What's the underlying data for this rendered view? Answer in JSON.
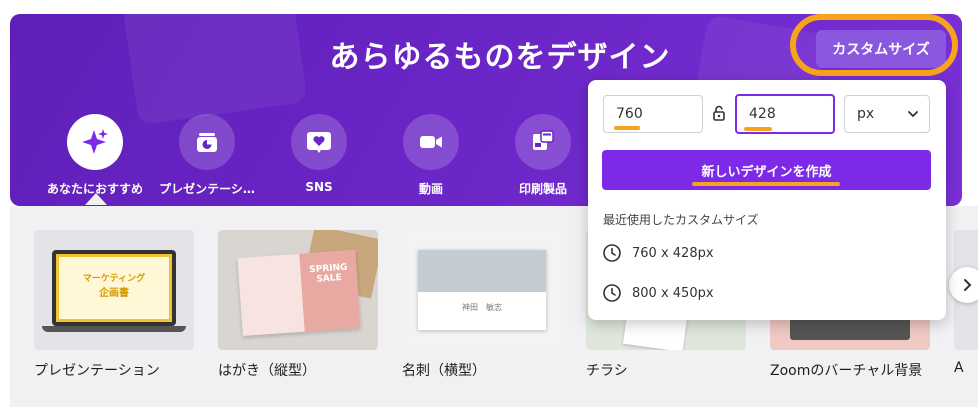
{
  "hero": {
    "title": "あらゆるものをデザイン",
    "custom_size_button": "カスタムサイズ"
  },
  "categories": [
    {
      "label": "あなたにおすすめ",
      "icon": "sparkle-icon",
      "active": true
    },
    {
      "label": "プレゼンテーシ…",
      "icon": "presentation-icon",
      "active": false
    },
    {
      "label": "SNS",
      "icon": "heart-chat-icon",
      "active": false
    },
    {
      "label": "動画",
      "icon": "video-camera-icon",
      "active": false
    },
    {
      "label": "印刷製品",
      "icon": "print-icon",
      "active": false
    }
  ],
  "custom_size_popup": {
    "width_value": "760",
    "height_value": "428",
    "unit": "px",
    "create_button": "新しいデザインを作成",
    "recent_title": "最近使用したカスタムサイズ",
    "recent_sizes": [
      "760 x 428px",
      "800 x 450px"
    ]
  },
  "templates": [
    {
      "label": "プレゼンテーション",
      "thumb_text": [
        "マーケティング",
        "企画書"
      ]
    },
    {
      "label": "はがき（縦型）",
      "thumb_text": [
        "SPRING",
        "SALE"
      ]
    },
    {
      "label": "名刺（横型）",
      "thumb_text": [
        "神田　敏志"
      ]
    },
    {
      "label": "チラシ"
    },
    {
      "label": "Zoomのバーチャル背景"
    },
    {
      "label": "A"
    }
  ],
  "colors": {
    "brand_purple": "#7d2ae8",
    "hero_purple": "#6a25c6",
    "annotation_orange": "#f6a41c"
  }
}
